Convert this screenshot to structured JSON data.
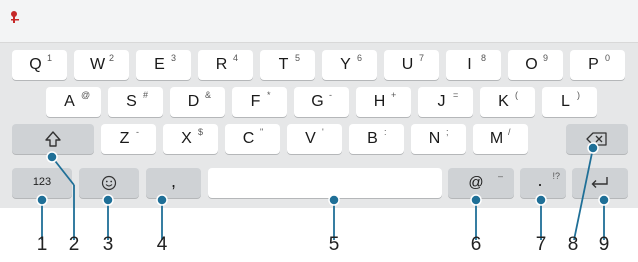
{
  "keyboard": {
    "row1": [
      {
        "label": "Q",
        "sup": "1"
      },
      {
        "label": "W",
        "sup": "2"
      },
      {
        "label": "E",
        "sup": "3"
      },
      {
        "label": "R",
        "sup": "4"
      },
      {
        "label": "T",
        "sup": "5"
      },
      {
        "label": "Y",
        "sup": "6"
      },
      {
        "label": "U",
        "sup": "7"
      },
      {
        "label": "I",
        "sup": "8"
      },
      {
        "label": "O",
        "sup": "9"
      },
      {
        "label": "P",
        "sup": "0"
      }
    ],
    "row2": [
      {
        "label": "A",
        "sup": "@"
      },
      {
        "label": "S",
        "sup": "#"
      },
      {
        "label": "D",
        "sup": "&"
      },
      {
        "label": "F",
        "sup": "*"
      },
      {
        "label": "G",
        "sup": "-"
      },
      {
        "label": "H",
        "sup": "+"
      },
      {
        "label": "J",
        "sup": "="
      },
      {
        "label": "K",
        "sup": "("
      },
      {
        "label": "L",
        "sup": ")"
      }
    ],
    "row3": [
      {
        "label": "Z",
        "sup": "-"
      },
      {
        "label": "X",
        "sup": "$"
      },
      {
        "label": "C",
        "sup": "\""
      },
      {
        "label": "V",
        "sup": "'"
      },
      {
        "label": "B",
        "sup": ":"
      },
      {
        "label": "N",
        "sup": ";"
      },
      {
        "label": "M",
        "sup": "/"
      }
    ],
    "row4": {
      "numbers_label": "123",
      "comma_label": ",",
      "at_label": "@",
      "at_sup": "–",
      "period_label": ".",
      "period_sup": "!?"
    }
  },
  "callouts": [
    "1",
    "2",
    "3",
    "4",
    "5",
    "6",
    "7",
    "8",
    "9"
  ],
  "icons": {
    "shift": "shift-icon",
    "backspace": "backspace-icon",
    "emoji": "emoji-icon",
    "enter": "enter-icon",
    "top_glyph": "pin-icon"
  },
  "colors": {
    "keyboard_bg": "#e6e7e8",
    "key_bg": "#ffffff",
    "function_key_bg": "#cfd2d5",
    "callout_line": "#1f6f97",
    "glyph_red": "#c62828"
  }
}
